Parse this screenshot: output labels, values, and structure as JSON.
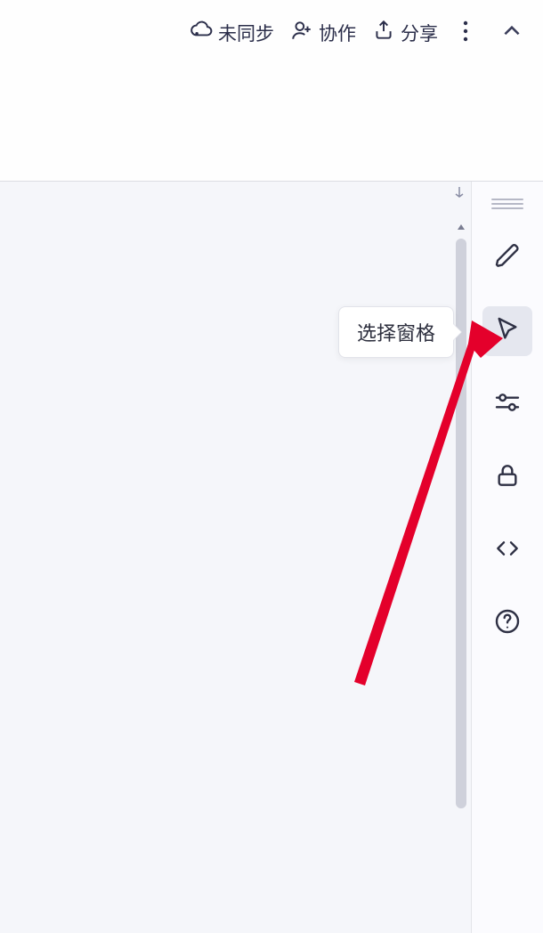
{
  "topbar": {
    "sync_label": "未同步",
    "collab_label": "协作",
    "share_label": "分享"
  },
  "sidebar": {
    "tooltip": "选择窗格",
    "items": [
      {
        "name": "edit-pencil-icon"
      },
      {
        "name": "select-cursor-icon",
        "active": true
      },
      {
        "name": "settings-sliders-icon"
      },
      {
        "name": "lock-icon"
      },
      {
        "name": "code-icon"
      },
      {
        "name": "help-icon"
      }
    ]
  }
}
